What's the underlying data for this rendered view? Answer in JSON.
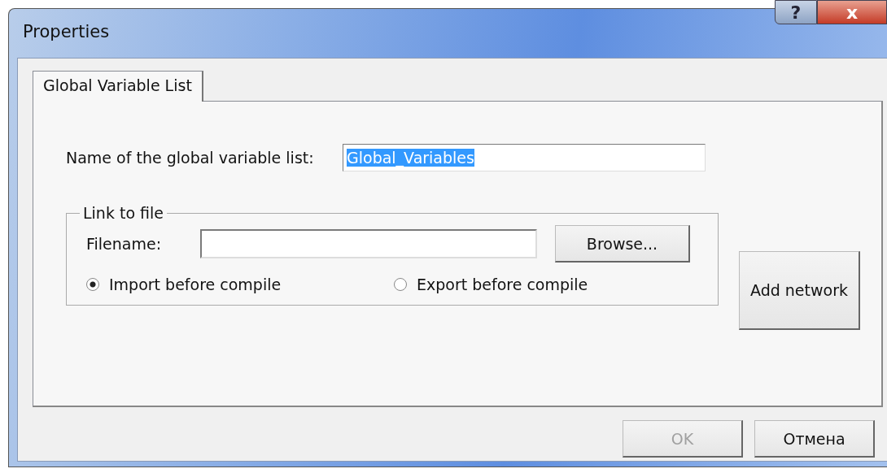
{
  "window": {
    "title": "Properties",
    "help_button": "?",
    "close_button": "x"
  },
  "tabs": [
    {
      "label": "Global Variable List",
      "selected": true
    }
  ],
  "name_field": {
    "label": "Name of the global variable list:",
    "value": "Global_Variables",
    "text_selected": true
  },
  "link_group": {
    "title": "Link to file",
    "filename_label": "Filename:",
    "browse_button": "Browse...",
    "options": [
      {
        "label": "Import before compile",
        "selected": true
      },
      {
        "label": "Export before compile",
        "selected": false
      }
    ]
  },
  "add_network_button": "Add network",
  "buttons": [
    {
      "label": "OK",
      "disabled": true
    },
    {
      "label": "Отмена",
      "disabled": false
    }
  ]
}
